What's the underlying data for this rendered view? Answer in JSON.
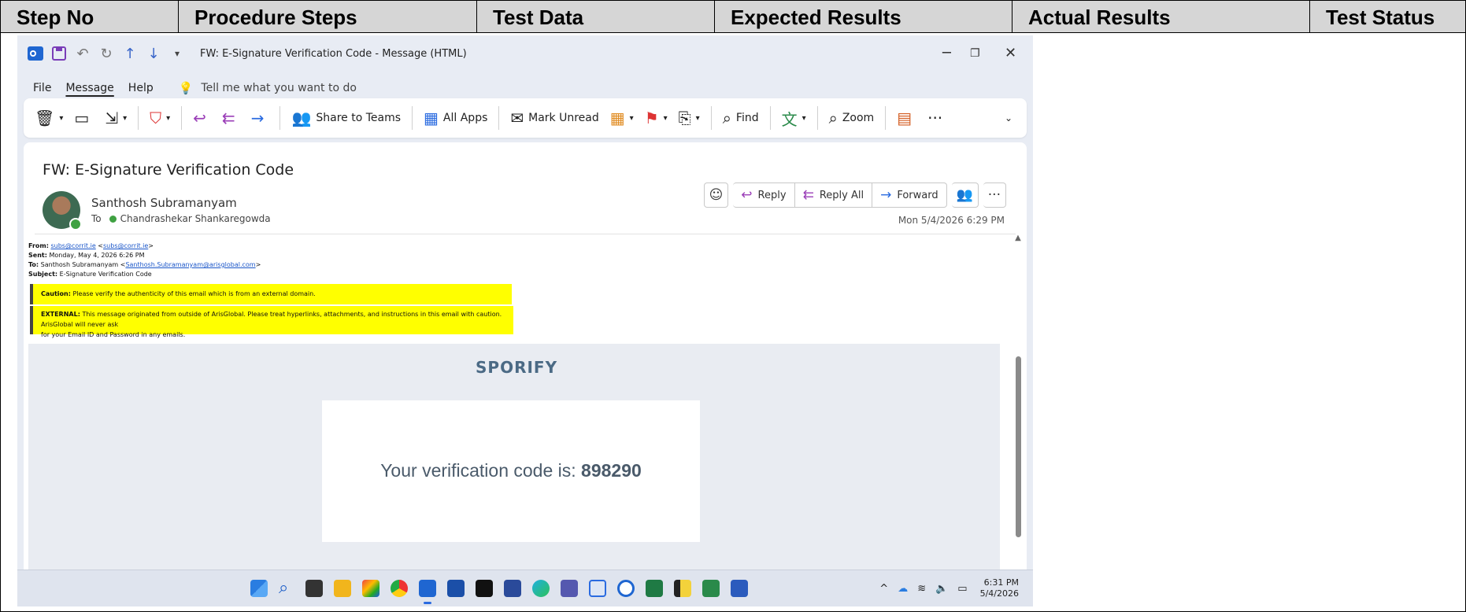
{
  "table": {
    "headers": [
      "Step No",
      "Procedure Steps",
      "Test Data",
      "Expected Results",
      "Actual Results",
      "Test Status"
    ]
  },
  "window": {
    "title": "FW: E-Signature Verification Code  -  Message (HTML)",
    "menu": {
      "file": "File",
      "message": "Message",
      "help": "Help",
      "tell_me": "Tell me what you want to do"
    }
  },
  "ribbon": {
    "share_to_teams": "Share to Teams",
    "all_apps": "All Apps",
    "mark_unread": "Mark Unread",
    "find": "Find",
    "zoom": "Zoom"
  },
  "message": {
    "subject": "FW: E-Signature Verification Code",
    "sender": "Santhosh Subramanyam",
    "to_label": "To",
    "recipient": "Chandrashekar Shankaregowda",
    "date": "Mon 5/4/2026 6:29 PM",
    "actions": {
      "reply": "Reply",
      "reply_all": "Reply All",
      "forward": "Forward"
    }
  },
  "forwarded": {
    "from_label": "From:",
    "from_link1": "subs@corrit.ie",
    "from_link2": "subs@corrit.ie",
    "sent_label": "Sent:",
    "sent_value": "Monday, May 4, 2026 6:26 PM",
    "to_label": "To:",
    "to_name": "Santhosh Subramanyam",
    "to_email": "Santhosh.Subramanyam@arisglobal.com",
    "subject_label": "Subject:",
    "subject_value": "E-Signature Verification Code"
  },
  "banners": {
    "caution_label": "Caution:",
    "caution_text": "Please verify the authenticity of this email which is from an external domain.",
    "external_label": "EXTERNAL:",
    "external_text_1": "This message originated from outside of ArisGlobal. Please treat hyperlinks, attachments, and instructions in this email with caution. ArisGlobal will never ask",
    "external_text_2": "for your Email ID and Password in any emails."
  },
  "email_body": {
    "logo": "SPORIFY",
    "code_prefix": "Your verification code is:",
    "code": "898290"
  },
  "taskbar": {
    "time": "6:31 PM",
    "date": "5/4/2026"
  },
  "colors": {
    "banner_yellow": "#ffff00",
    "presence_green": "#3fa142",
    "link_blue": "#1a56c9",
    "table_header_gray": "#d6d6d6"
  }
}
